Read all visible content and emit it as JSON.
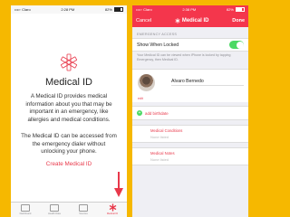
{
  "left_phone": {
    "status": {
      "carrier": "••••◦ Claro",
      "time": "2:28 PM",
      "battery": "82%"
    },
    "title": "Medical ID",
    "description": "A Medical ID provides medical information about you that may be important in an emergency, like allergies and medical conditions.",
    "description2": "The Medical ID can be accessed from the emergency dialer without unlocking your phone.",
    "create_link": "Create Medical ID",
    "tabs": [
      {
        "label": "Dashboard",
        "icon": "chart-icon"
      },
      {
        "label": "Health Data",
        "icon": "grid-icon"
      },
      {
        "label": "Sources",
        "icon": "heart-icon"
      },
      {
        "label": "Medical ID",
        "icon": "star-of-life-icon",
        "active": true
      }
    ],
    "colors": {
      "accent": "#e8384a",
      "arrow": "#e8384a"
    }
  },
  "right_phone": {
    "status": {
      "carrier": "••••◦ Claro",
      "time": "2:38 PM",
      "battery": "82%"
    },
    "nav": {
      "cancel": "Cancel",
      "title": "Medical ID",
      "done": "Done"
    },
    "section_header": "EMERGENCY ACCESS",
    "show_when_locked": {
      "label": "Show When Locked",
      "on": true
    },
    "footnote": "Your Medical ID can be viewed when iPhone is locked by tapping Emergency, then Medical ID.",
    "profile": {
      "name": "Alvaro Bernedo",
      "edit": "edit"
    },
    "add_birthdate": "add birthdate",
    "fields": [
      {
        "label": "Medical Conditions",
        "value": "None listed"
      },
      {
        "label": "Medical Notes",
        "value": "None listed"
      }
    ],
    "colors": {
      "header": "#f4364c",
      "toggle_on": "#4cd964"
    }
  },
  "background_color": "#f6b800"
}
